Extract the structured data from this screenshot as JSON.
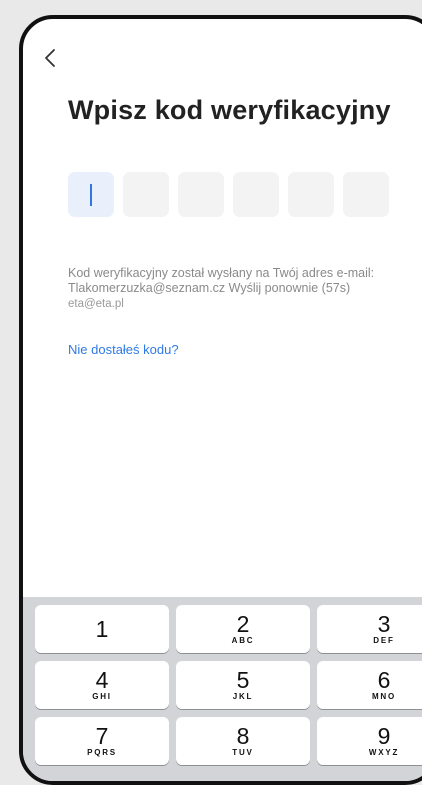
{
  "header": {
    "back_icon": "chevron-left-icon",
    "title": "Wpisz kod weryfikacyjny"
  },
  "code": {
    "length": 6,
    "focused_index": 0,
    "active_color": "#e9f0fb",
    "caret_color": "#3377e0"
  },
  "info": {
    "text": "Kod weryfikacyjny został wysłany na Twój adres e-mail: Tlakomerzuzka@seznam.cz",
    "resend": "Wyślij ponownie (57s)",
    "email_hint": "eta@eta.pl"
  },
  "help_link": {
    "label": "Nie dostałeś kodu?",
    "color": "#2f7ae5"
  },
  "keypad": {
    "keys": [
      {
        "digit": "1",
        "letters": ""
      },
      {
        "digit": "2",
        "letters": "ABC"
      },
      {
        "digit": "3",
        "letters": "DEF"
      },
      {
        "digit": "4",
        "letters": "GHI"
      },
      {
        "digit": "5",
        "letters": "JKL"
      },
      {
        "digit": "6",
        "letters": "MNO"
      },
      {
        "digit": "7",
        "letters": "PQRS"
      },
      {
        "digit": "8",
        "letters": "TUV"
      },
      {
        "digit": "9",
        "letters": "WXYZ"
      }
    ]
  }
}
